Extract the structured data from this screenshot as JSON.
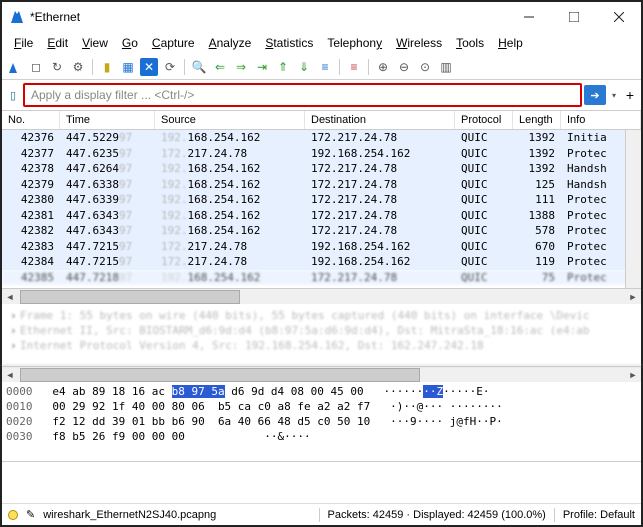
{
  "window": {
    "title": "*Ethernet"
  },
  "menus": {
    "file": "File",
    "edit": "Edit",
    "view": "View",
    "go": "Go",
    "capture": "Capture",
    "analyze": "Analyze",
    "statistics": "Statistics",
    "telephony": "Telephony",
    "wireless": "Wireless",
    "tools": "Tools",
    "help": "Help"
  },
  "filter": {
    "placeholder": "Apply a display filter ... <Ctrl-/>"
  },
  "columns": {
    "no": "No.",
    "time": "Time",
    "source": "Source",
    "destination": "Destination",
    "protocol": "Protocol",
    "length": "Length",
    "info": "Info"
  },
  "packets": [
    {
      "no": "42376",
      "time": "447.5229",
      "src_blur": "192.",
      "src": "168.254.162",
      "dst": "172.217.24.78",
      "proto": "QUIC",
      "len": "1392",
      "info": "Initia"
    },
    {
      "no": "42377",
      "time": "447.6235",
      "src_blur": "172.",
      "src": "217.24.78",
      "dst": "192.168.254.162",
      "proto": "QUIC",
      "len": "1392",
      "info": "Protec"
    },
    {
      "no": "42378",
      "time": "447.6264",
      "src_blur": "192.",
      "src": "168.254.162",
      "dst": "172.217.24.78",
      "proto": "QUIC",
      "len": "1392",
      "info": "Handsh"
    },
    {
      "no": "42379",
      "time": "447.6338",
      "src_blur": "192.",
      "src": "168.254.162",
      "dst": "172.217.24.78",
      "proto": "QUIC",
      "len": "125",
      "info": "Handsh"
    },
    {
      "no": "42380",
      "time": "447.6339",
      "src_blur": "192.",
      "src": "168.254.162",
      "dst": "172.217.24.78",
      "proto": "QUIC",
      "len": "111",
      "info": "Protec"
    },
    {
      "no": "42381",
      "time": "447.6343",
      "src_blur": "192.",
      "src": "168.254.162",
      "dst": "172.217.24.78",
      "proto": "QUIC",
      "len": "1388",
      "info": "Protec"
    },
    {
      "no": "42382",
      "time": "447.6343",
      "src_blur": "192.",
      "src": "168.254.162",
      "dst": "172.217.24.78",
      "proto": "QUIC",
      "len": "578",
      "info": "Protec"
    },
    {
      "no": "42383",
      "time": "447.7215",
      "src_blur": "172.",
      "src": "217.24.78",
      "dst": "192.168.254.162",
      "proto": "QUIC",
      "len": "670",
      "info": "Protec"
    },
    {
      "no": "42384",
      "time": "447.7215",
      "src_blur": "172.",
      "src": "217.24.78",
      "dst": "192.168.254.162",
      "proto": "QUIC",
      "len": "119",
      "info": "Protec"
    },
    {
      "no": "42385",
      "time": "447.7218",
      "src_blur": "192.",
      "src": "168.254.162",
      "dst": "172.217.24.78",
      "proto": "QUIC",
      "len": "75",
      "info": "Protec"
    }
  ],
  "details": {
    "l1": "Frame 1: 55 bytes on wire (440 bits), 55 bytes captured (440 bits) on interface \\Devic",
    "l2": "Ethernet II, Src: BIOSTARM_d6:9d:d4 (b8:97:5a:d6:9d:d4), Dst: MitraSta_18:16:ac (e4:ab",
    "l3": "Internet Protocol Version 4, Src: 192.168.254.162, Dst: 162.247.242.18"
  },
  "hex": {
    "r0": {
      "off": "0000",
      "b": "e4 ab 89 18 16 ac ",
      "sel": "b8 97 5a",
      "b2": " d6 9d d4 08 00 45 00",
      "asc": "   ······",
      "asel": "··Z",
      "asc2": "·····E·"
    },
    "r1": {
      "off": "0010",
      "b": "00 29 92 1f 40 00 80 06  b5 ca c0 a8 fe a2 a2 f7",
      "asc": "   ·)··@··· ········"
    },
    "r2": {
      "off": "0020",
      "b": "f2 12 dd 39 01 bb b6 90  6a 40 66 48 d5 c0 50 10",
      "asc": "   ···9···· j@fH··P·"
    },
    "r3": {
      "off": "0030",
      "b": "f8 b5 26 f9 00 00 00",
      "asc": "            ··&····"
    }
  },
  "status": {
    "filename": "wireshark_EthernetN2SJ40.pcapng",
    "packets": "Packets: 42459 · Displayed: 42459 (100.0%)",
    "profile": "Profile: Default"
  }
}
